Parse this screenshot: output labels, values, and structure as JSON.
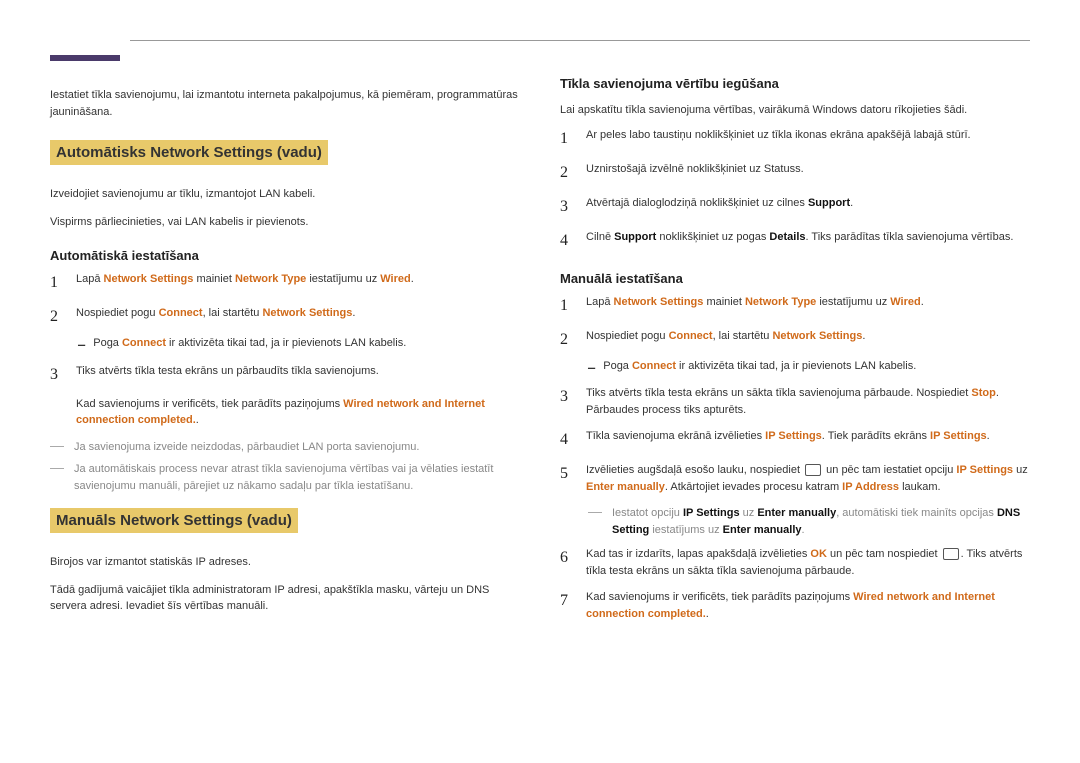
{
  "intro_left": "Iestatiet tīkla savienojumu, lai izmantotu interneta pakalpojumus, kā piemēram, programmatūras jaunināšana.",
  "section_a": {
    "title": "Automātisks Network Settings (vadu)",
    "p1": "Izveidojiet savienojumu ar tīklu, izmantojot LAN kabeli.",
    "p2": "Vispirms pārliecinieties, vai LAN kabelis ir pievienots.",
    "sub": "Automātiskā iestatīšana",
    "step1_a": "Lapā ",
    "step1_b": "Network Settings",
    "step1_c": " mainiet ",
    "step1_d": "Network Type",
    "step1_e": " iestatījumu uz ",
    "step1_f": "Wired",
    "step1_g": ".",
    "step2_a": "Nospiediet pogu ",
    "step2_b": "Connect",
    "step2_c": ", lai startētu ",
    "step2_d": "Network Settings",
    "step2_e": ".",
    "dash_a": "Poga ",
    "dash_b": "Connect",
    "dash_c": " ir aktivizēta tikai tad, ja ir pievienots LAN kabelis.",
    "step3": "Tiks atvērts tīkla testa ekrāns un pārbaudīts tīkla savienojums.",
    "step3_after_a": "Kad savienojums ir verificēts, tiek parādīts paziņojums ",
    "step3_after_b": "Wired network and Internet connection completed.",
    "step3_after_c": ".",
    "note1": "Ja savienojuma izveide neizdodas, pārbaudiet LAN porta savienojumu.",
    "note2": "Ja automātiskais process nevar atrast tīkla savienojuma vērtības vai ja vēlaties iestatīt savienojumu manuāli, pārejiet uz nākamo sadaļu par tīkla iestatīšanu."
  },
  "section_b": {
    "title": "Manuāls Network Settings (vadu)",
    "p1": "Birojos var izmantot statiskās IP adreses.",
    "p2": "Tādā gadījumā vaicājiet tīkla administratoram IP adresi, apakštīkla masku, vārteju un DNS servera adresi. Ievadiet šīs vērtības manuāli."
  },
  "right": {
    "sub1": "Tīkla savienojuma vērtību iegūšana",
    "r_p1": "Lai apskatītu tīkla savienojuma vērtības, vairākumā Windows datoru rīkojieties šādi.",
    "r1": "Ar peles labo taustiņu noklikšķiniet uz tīkla ikonas ekrāna apakšējā labajā stūrī.",
    "r2": "Uznirstošajā izvēlnē noklikšķiniet uz Statuss.",
    "r3_a": "Atvērtajā dialoglodziņā noklikšķiniet uz cilnes ",
    "r3_b": "Support",
    "r3_c": ".",
    "r4_a": "Cilnē ",
    "r4_b": "Support",
    "r4_c": " noklikšķiniet uz pogas ",
    "r4_d": "Details",
    "r4_e": ". Tiks parādītas tīkla savienojuma vērtības.",
    "sub2": "Manuālā iestatīšana",
    "m1_a": "Lapā ",
    "m1_b": "Network Settings",
    "m1_c": " mainiet ",
    "m1_d": "Network Type",
    "m1_e": " iestatījumu uz ",
    "m1_f": "Wired",
    "m1_g": ".",
    "m2_a": "Nospiediet pogu ",
    "m2_b": "Connect",
    "m2_c": ", lai startētu ",
    "m2_d": "Network Settings",
    "m2_e": ".",
    "mdash_a": "Poga ",
    "mdash_b": "Connect",
    "mdash_c": " ir aktivizēta tikai tad, ja ir pievienots LAN kabelis.",
    "m3_a": "Tiks atvērts tīkla testa ekrāns un sākta tīkla savienojuma pārbaude. Nospiediet ",
    "m3_b": "Stop",
    "m3_c": ". Pārbaudes process tiks apturēts.",
    "m4_a": "Tīkla savienojuma ekrānā izvēlieties ",
    "m4_b": "IP Settings",
    "m4_c": ". Tiek parādīts ekrāns ",
    "m4_d": "IP Settings",
    "m4_e": ".",
    "m5_a": "Izvēlieties augšdaļā esošo lauku, nospiediet ",
    "m5_b": " un pēc tam iestatiet opciju ",
    "m5_c": "IP Settings",
    "m5_d": " uz ",
    "m5_e": "Enter manually",
    "m5_f": ". Atkārtojiet ievades procesu katram ",
    "m5_g": "IP Address",
    "m5_h": " laukam.",
    "mnote_a": "Iestatot opciju ",
    "mnote_b": "IP Settings",
    "mnote_c": " uz ",
    "mnote_d": "Enter manually",
    "mnote_e": ", automātiski tiek mainīts opcijas ",
    "mnote_f": "DNS Setting",
    "mnote_g": " iestatījums uz ",
    "mnote_h": "Enter manually",
    "mnote_i": ".",
    "m6_a": "Kad tas ir izdarīts, lapas apakšdaļā izvēlieties ",
    "m6_b": "OK",
    "m6_c": " un pēc tam nospiediet ",
    "m6_d": ". Tiks atvērts tīkla testa ekrāns un sākta tīkla savienojuma pārbaude.",
    "m7_a": "Kad savienojums ir verificēts, tiek parādīts paziņojums ",
    "m7_b": "Wired network and Internet connection completed.",
    "m7_c": "."
  }
}
